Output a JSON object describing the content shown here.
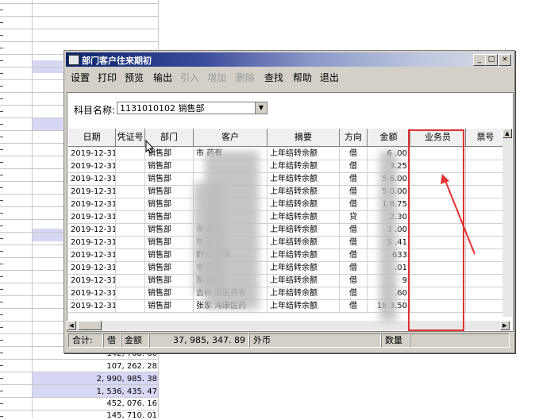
{
  "window": {
    "title": "部门客户往来期初",
    "minimize": "_",
    "maximize": "□",
    "close": "×"
  },
  "menu": [
    {
      "label": "设置",
      "enabled": true
    },
    {
      "label": "打印",
      "enabled": true
    },
    {
      "label": "预览",
      "enabled": true
    },
    {
      "label": "输出",
      "enabled": true
    },
    {
      "label": "引入",
      "enabled": false
    },
    {
      "label": "增加",
      "enabled": false
    },
    {
      "label": "删除",
      "enabled": false
    },
    {
      "label": "查找",
      "enabled": true
    },
    {
      "label": "帮助",
      "enabled": true
    },
    {
      "label": "退出",
      "enabled": true
    }
  ],
  "subject": {
    "label": "科目名称:",
    "value": "1131010102 销售部"
  },
  "table": {
    "columns": [
      "日期",
      "凭证号",
      "部门",
      "客户",
      "摘要",
      "方向",
      "金额",
      "业务员",
      "票号"
    ],
    "rows": [
      {
        "date": "2019-12-31",
        "voucher": "",
        "dept": "销售部",
        "customer": "市 药有",
        "summary": "上年结转余额",
        "dir": "借",
        "amount": "6 .00",
        "staff": "",
        "ticket": ""
      },
      {
        "date": "2019-12-31",
        "voucher": "",
        "dept": "销售部",
        "customer": "",
        "summary": "上年结转余额",
        "dir": "借",
        "amount": "3.25",
        "staff": "",
        "ticket": ""
      },
      {
        "date": "2019-12-31",
        "voucher": "",
        "dept": "销售部",
        "customer": "",
        "summary": "上年结转余额",
        "dir": "借",
        "amount": "5 6.00",
        "staff": "",
        "ticket": ""
      },
      {
        "date": "2019-12-31",
        "voucher": "",
        "dept": "销售部",
        "customer": "",
        "summary": "上年结转余额",
        "dir": "借",
        "amount": "5 0.00",
        "staff": "",
        "ticket": ""
      },
      {
        "date": "2019-12-31",
        "voucher": "",
        "dept": "销售部",
        "customer": "",
        "summary": "上年结转余额",
        "dir": "借",
        "amount": "1 8.75",
        "staff": "",
        "ticket": ""
      },
      {
        "date": "2019-12-31",
        "voucher": "",
        "dept": "销售部",
        "customer": "",
        "summary": "上年结转余额",
        "dir": "贷",
        "amount": "2.30",
        "staff": "",
        "ticket": ""
      },
      {
        "date": "2019-12-31",
        "voucher": "",
        "dept": "销售部",
        "customer": "市 药有",
        "summary": "上年结转余额",
        "dir": "借",
        "amount": "3 .00",
        "staff": "",
        "ticket": ""
      },
      {
        "date": "2019-12-31",
        "voucher": "",
        "dept": "销售部",
        "customer": "市 药有",
        "summary": "上年结转余额",
        "dir": "借",
        "amount": "5 .41",
        "staff": "",
        "ticket": ""
      },
      {
        "date": "2019-12-31",
        "voucher": "",
        "dept": "销售部",
        "customer": "野天 有限",
        "summary": "上年结转余额",
        "dir": "借",
        "amount": "633",
        "staff": "",
        "ticket": ""
      },
      {
        "date": "2019-12-31",
        "voucher": "",
        "dept": "销售部",
        "customer": "市 药有",
        "summary": "上年结转余额",
        "dir": "借",
        "amount": ".01",
        "staff": "",
        "ticket": ""
      },
      {
        "date": "2019-12-31",
        "voucher": "",
        "dept": "销售部",
        "customer": "家 医药",
        "summary": "上年结转余额",
        "dir": "借",
        "amount": "9",
        "staff": "",
        "ticket": ""
      },
      {
        "date": "2019-12-31",
        "voucher": "",
        "dept": "销售部",
        "customer": "吉林 康医药有",
        "summary": "上年结转余额",
        "dir": "借",
        "amount": ".60",
        "staff": "",
        "ticket": ""
      },
      {
        "date": "2019-12-31",
        "voucher": "",
        "dept": "销售部",
        "customer": "张家 海康医药",
        "summary": "上年结转余额",
        "dir": "借",
        "amount": "18 3.50",
        "staff": "",
        "ticket": ""
      }
    ]
  },
  "status": {
    "total_label": "合计:",
    "direction": "借",
    "amount_label": "金额",
    "amount": "37, 985, 347. 89",
    "foreign_label": "外币",
    "qty_label": "数量"
  },
  "sheet_numbers": [
    "142, 708. 66",
    "107, 262. 28",
    "2, 990, 985. 38",
    "1, 536, 435. 47",
    "452, 076. 16",
    "145, 710. 01"
  ],
  "colors": {
    "annotation_red": "#e53030",
    "title_blue": "#0a246a"
  },
  "icons": {
    "window": "app-window-icon",
    "dropdown": "chevron-down-icon",
    "cursor": "mouse-pointer-icon"
  }
}
